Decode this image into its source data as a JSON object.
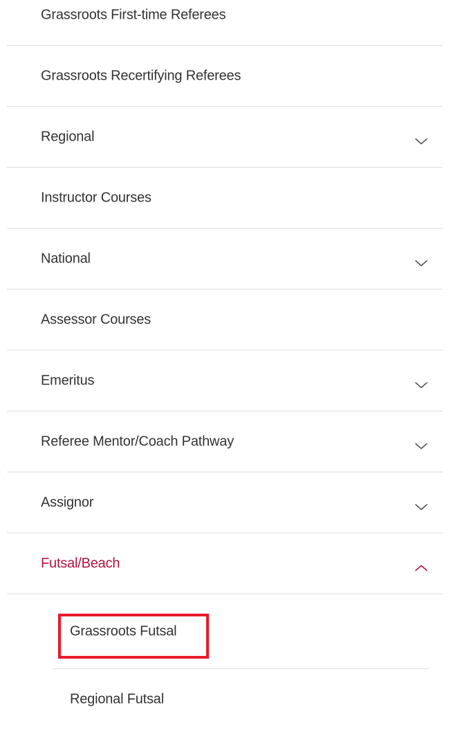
{
  "menu": {
    "items": [
      {
        "label": "Grassroots First-time Referees",
        "chevron": "none"
      },
      {
        "label": "Grassroots Recertifying Referees",
        "chevron": "none"
      },
      {
        "label": "Regional",
        "chevron": "down"
      },
      {
        "label": "Instructor Courses",
        "chevron": "none"
      },
      {
        "label": "National",
        "chevron": "down"
      },
      {
        "label": "Assessor Courses",
        "chevron": "none"
      },
      {
        "label": "Emeritus",
        "chevron": "down"
      },
      {
        "label": "Referee Mentor/Coach Pathway",
        "chevron": "down"
      },
      {
        "label": "Assignor",
        "chevron": "down"
      },
      {
        "label": "Futsal/Beach",
        "chevron": "up"
      }
    ],
    "active_index": 9
  },
  "submenu": {
    "items": [
      {
        "label": "Grassroots Futsal"
      },
      {
        "label": "Regional Futsal"
      }
    ],
    "highlighted_index": 0
  },
  "icons": {
    "chevron_down": "chevron-down-icon",
    "chevron_up": "chevron-up-icon"
  },
  "colors": {
    "active_text": "#b5123f",
    "highlight_box": "#e8192c",
    "divider": "#dedede",
    "chevron_default": "#555555",
    "chevron_active": "#b5123f"
  }
}
